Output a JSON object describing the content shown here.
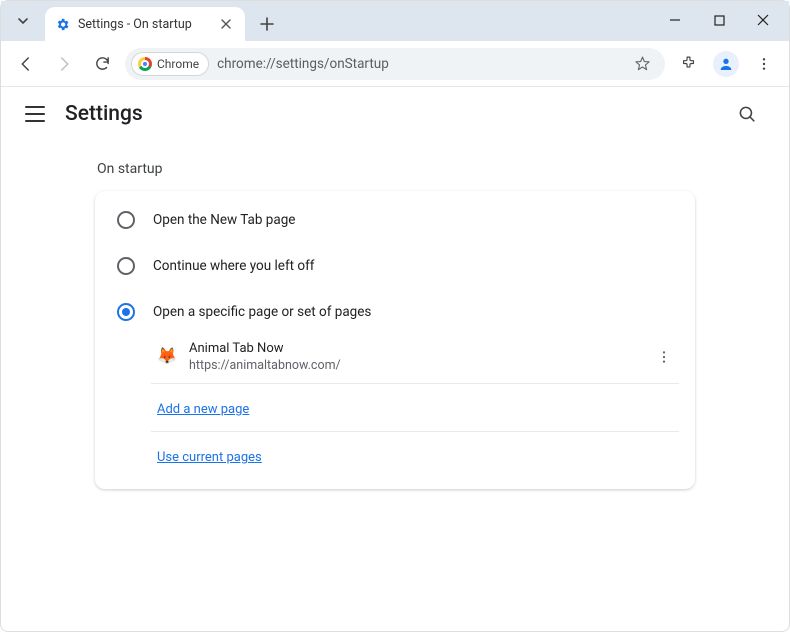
{
  "browser": {
    "tab_title": "Settings - On startup",
    "omnibox_chip": "Chrome",
    "url": "chrome://settings/onStartup"
  },
  "settings": {
    "header": "Settings",
    "section_title": "On startup",
    "radios": {
      "newtab": "Open the New Tab page",
      "continue": "Continue where you left off",
      "specific": "Open a specific page or set of pages"
    },
    "startup_page": {
      "name": "Animal Tab Now",
      "url": "https://animaltabnow.com/",
      "favicon": "🦊"
    },
    "links": {
      "add_page": "Add a new page",
      "use_current": "Use current pages"
    }
  }
}
